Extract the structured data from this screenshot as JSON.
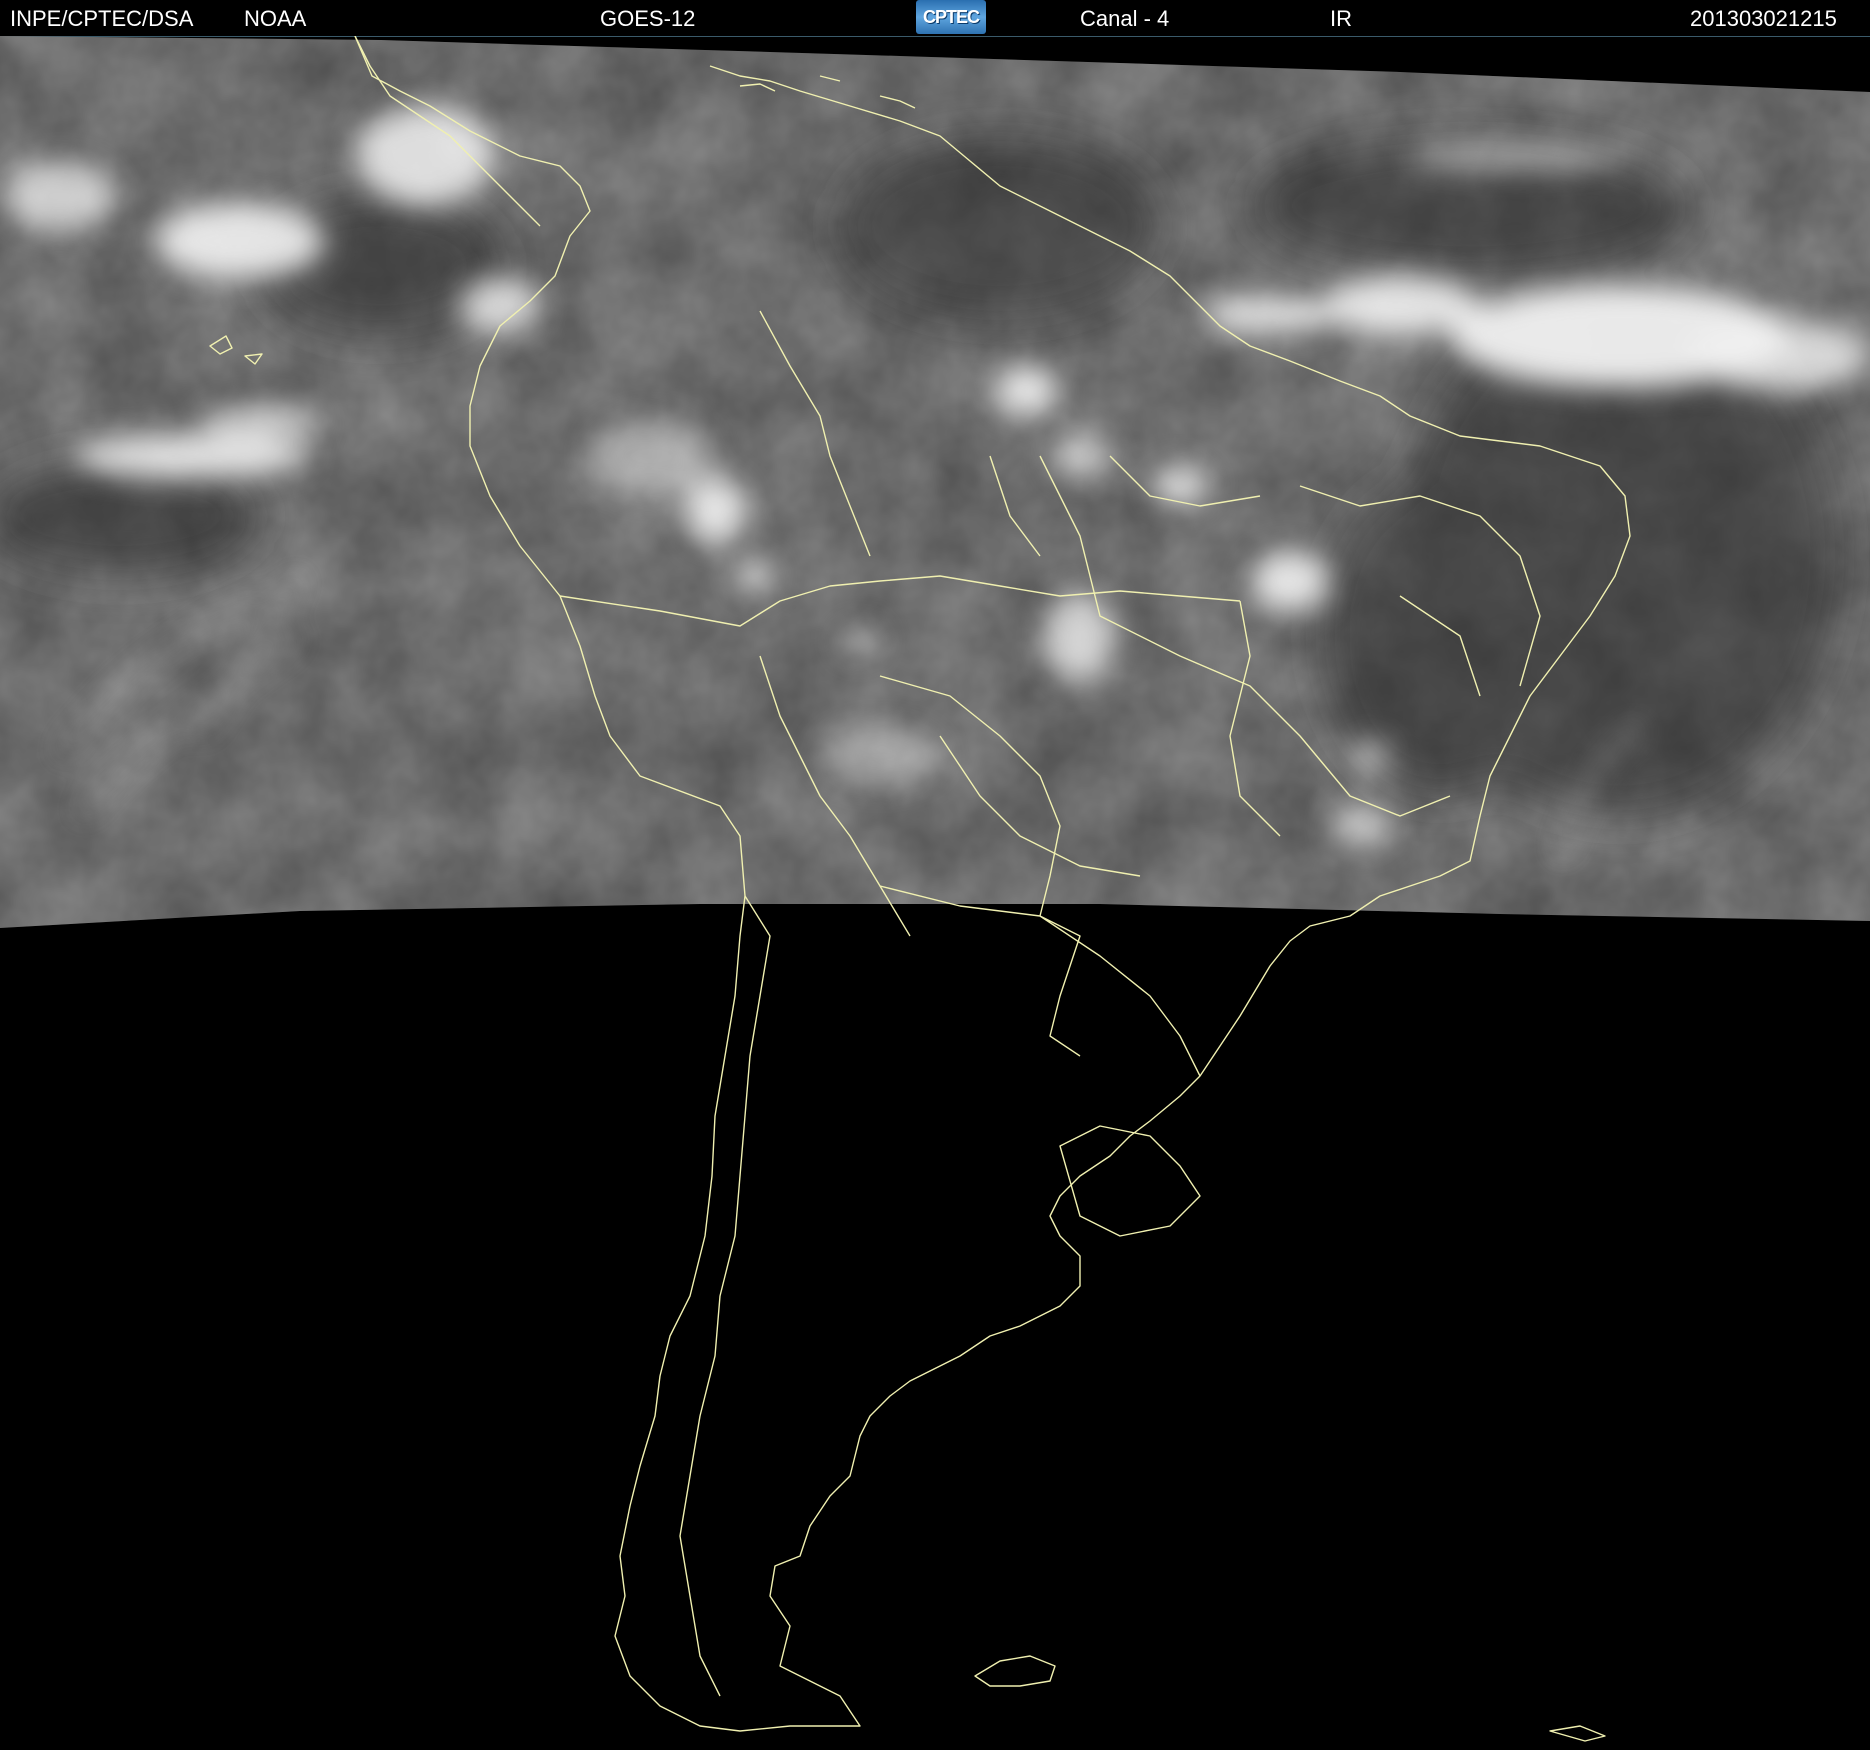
{
  "header": {
    "source": "INPE/CPTEC/DSA",
    "agency": "NOAA",
    "satellite": "GOES-12",
    "logo_text": "CPTEC",
    "channel": "Canal - 4",
    "band": "IR",
    "timestamp": "201303021215"
  },
  "colors": {
    "background": "#000000",
    "border_lines": "#f0f0b0",
    "cloud": "#e8e8e8",
    "surface": "#555555"
  }
}
